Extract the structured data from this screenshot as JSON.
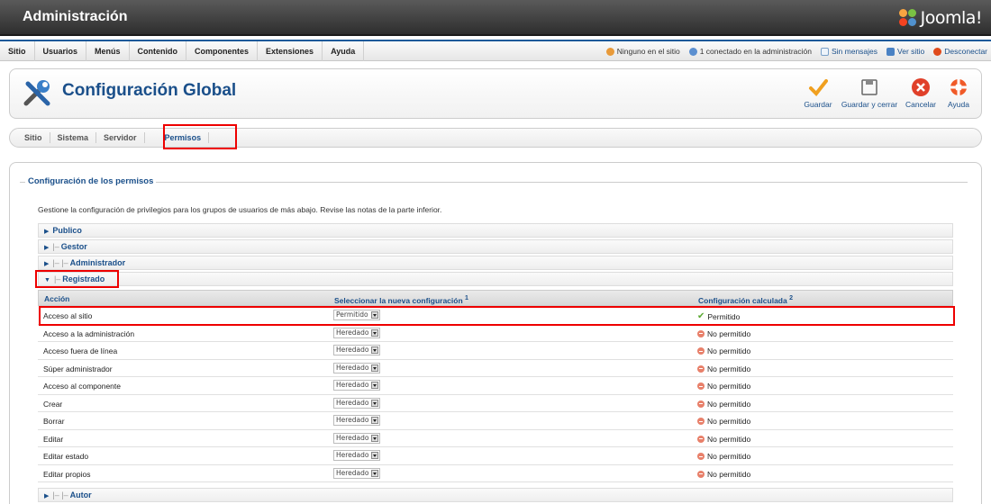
{
  "header": {
    "title": "Administración",
    "logo_text": "Joomla!"
  },
  "menu": {
    "items": [
      "Sitio",
      "Usuarios",
      "Menús",
      "Contenido",
      "Componentes",
      "Extensiones",
      "Ayuda"
    ]
  },
  "status": {
    "users_site": "Ninguno en el sitio",
    "users_admin": "1 conectado en la administración",
    "messages": "Sin mensajes",
    "view_site": "Ver sitio",
    "logout": "Desconectar"
  },
  "toolbar": {
    "page_title": "Configuración Global",
    "save": "Guardar",
    "save_close": "Guardar y cerrar",
    "cancel": "Cancelar",
    "help": "Ayuda"
  },
  "tabs": [
    "Sitio",
    "Sistema",
    "Servidor",
    "Permisos"
  ],
  "active_tab": "Permisos",
  "permissions": {
    "legend": "Configuración de los permisos",
    "description": "Gestione la configuración de privilegios para los grupos de usuarios de más abajo. Revise las notas de la parte inferior.",
    "groups": [
      {
        "label": "Publico",
        "tree": ""
      },
      {
        "label": "Gestor",
        "tree": "|–"
      },
      {
        "label": "Administrador",
        "tree": "|– |–"
      },
      {
        "label": "Registrado",
        "tree": "|–"
      },
      {
        "label": "Autor",
        "tree": "|– |–"
      }
    ],
    "columns": {
      "action": "Acción",
      "new_setting": "Seleccionar la nueva configuración",
      "new_setting_sup": "1",
      "calculated": "Configuración calculada",
      "calculated_sup": "2"
    },
    "rows": [
      {
        "action": "Acceso al sitio",
        "setting": "Permitido",
        "calculated": "Permitido",
        "allowed": true
      },
      {
        "action": "Acceso a la administración",
        "setting": "Heredado",
        "calculated": "No permitido",
        "allowed": false
      },
      {
        "action": "Acceso fuera de línea",
        "setting": "Heredado",
        "calculated": "No permitido",
        "allowed": false
      },
      {
        "action": "Súper administrador",
        "setting": "Heredado",
        "calculated": "No permitido",
        "allowed": false
      },
      {
        "action": "Acceso al componente",
        "setting": "Heredado",
        "calculated": "No permitido",
        "allowed": false
      },
      {
        "action": "Crear",
        "setting": "Heredado",
        "calculated": "No permitido",
        "allowed": false
      },
      {
        "action": "Borrar",
        "setting": "Heredado",
        "calculated": "No permitido",
        "allowed": false
      },
      {
        "action": "Editar",
        "setting": "Heredado",
        "calculated": "No permitido",
        "allowed": false
      },
      {
        "action": "Editar estado",
        "setting": "Heredado",
        "calculated": "No permitido",
        "allowed": false
      },
      {
        "action": "Editar propios",
        "setting": "Heredado",
        "calculated": "No permitido",
        "allowed": false
      }
    ]
  },
  "colors": {
    "link_blue": "#1a4f8a",
    "highlight_red": "#ee0000",
    "allowed_green": "#5aa832",
    "denied_red": "#e8806a"
  }
}
